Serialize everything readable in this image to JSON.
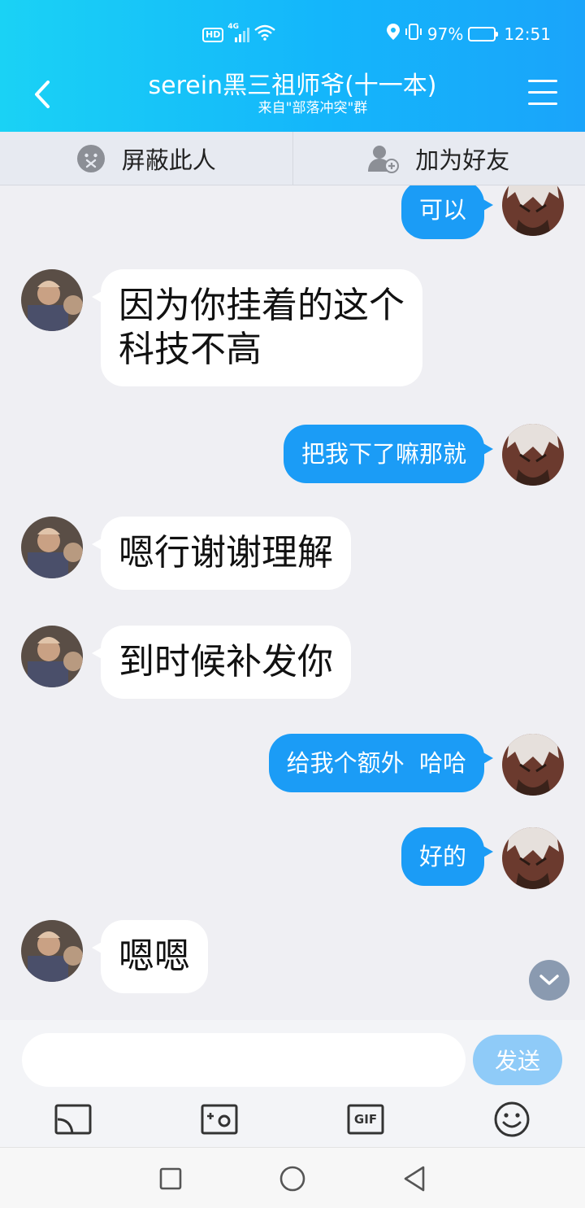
{
  "status_bar": {
    "hd_label": "HD",
    "network": "4G",
    "battery": "97%",
    "time": "12:51"
  },
  "header": {
    "title": "serein黑三祖师爷(十一本)",
    "subtitle": "来自\"部落冲突\"群"
  },
  "actions": {
    "block_label": "屏蔽此人",
    "add_friend_label": "加为好友"
  },
  "messages": [
    {
      "sender": "me",
      "text": "可以"
    },
    {
      "sender": "them",
      "text": "因为你挂着的这个\n科技不高"
    },
    {
      "sender": "me",
      "text": "把我下了嘛那就"
    },
    {
      "sender": "them",
      "text": "嗯行谢谢理解"
    },
    {
      "sender": "them",
      "text": "到时候补发你"
    },
    {
      "sender": "me",
      "text": "给我个额外  哈哈"
    },
    {
      "sender": "me",
      "text": "好的"
    },
    {
      "sender": "them",
      "text": "嗯嗯"
    }
  ],
  "input": {
    "placeholder": "",
    "send_label": "发送"
  },
  "toolbar": {
    "gif_label": "GIF"
  },
  "colors": {
    "header_gradient_start": "#1ad2f5",
    "header_gradient_end": "#1aa4fa",
    "my_bubble": "#1b9cf6",
    "send_button": "#8fcbf8"
  }
}
